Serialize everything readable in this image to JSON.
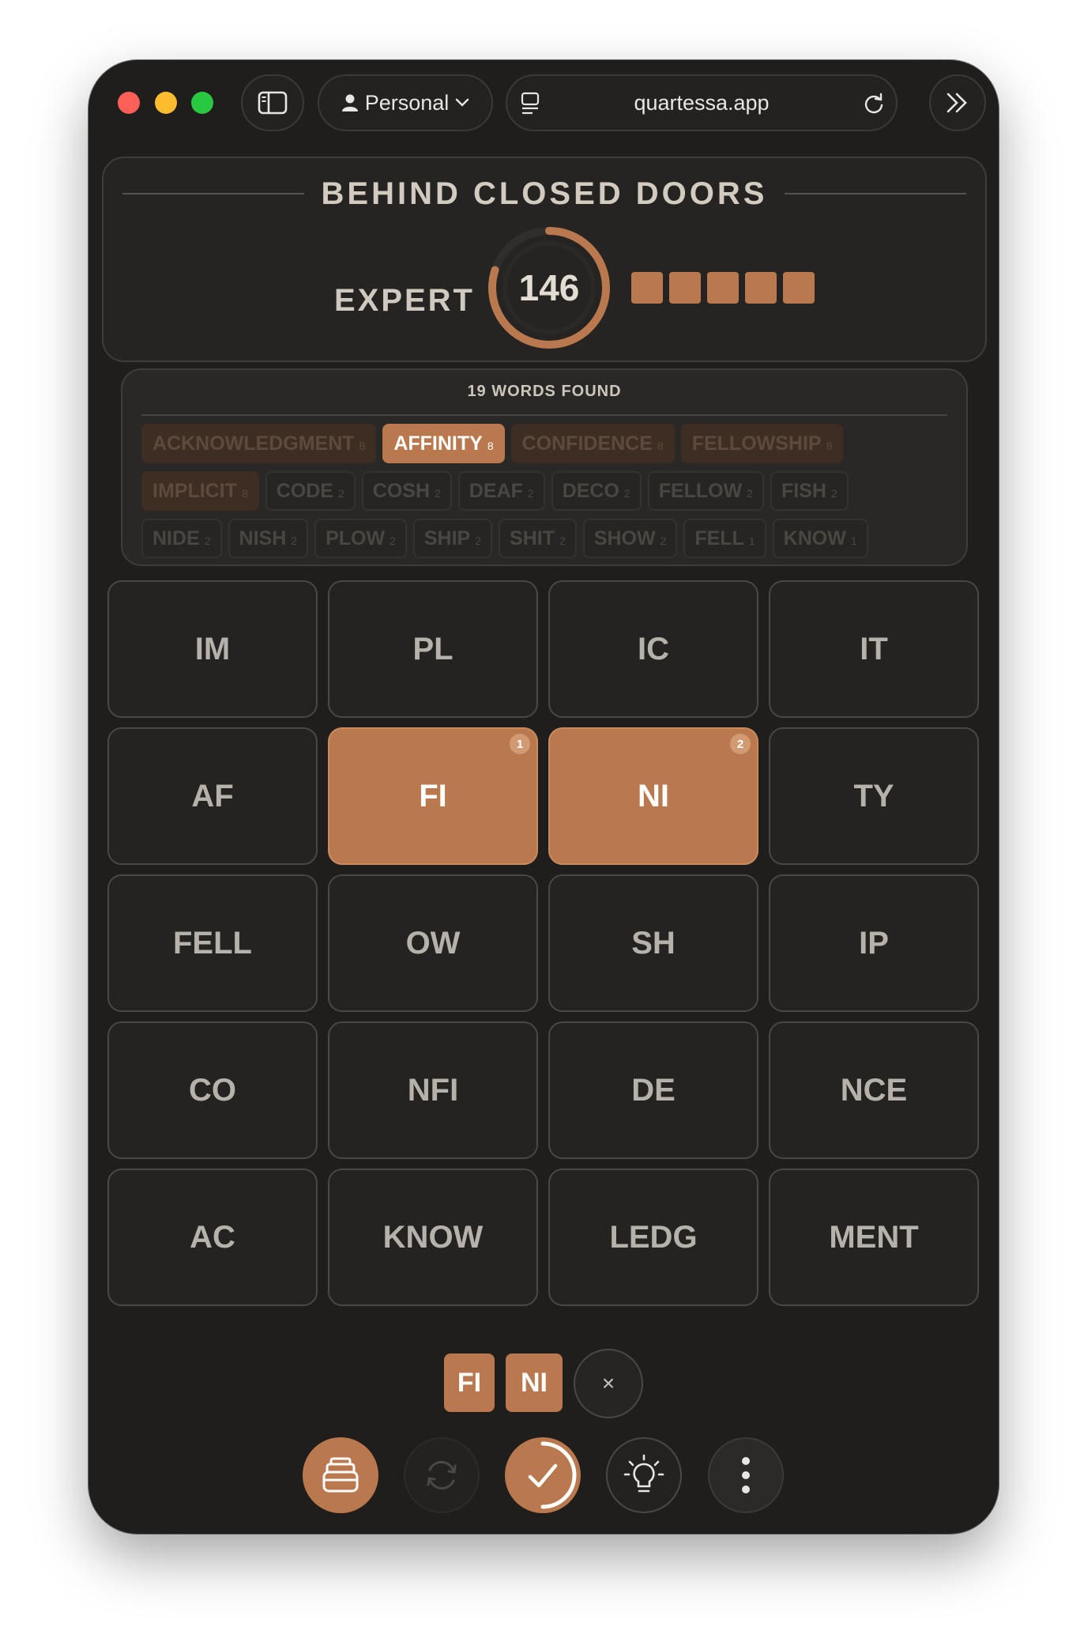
{
  "browser": {
    "profile_label": "Personal",
    "url": "quartessa.app"
  },
  "puzzle": {
    "title": "BEHIND CLOSED DOORS",
    "level": "EXPERT",
    "score": "146",
    "score_progress": 0.8,
    "progress_filled": 5
  },
  "found": {
    "title": "19 WORDS FOUND",
    "rows": [
      [
        {
          "word": "ACKNOWLEDGMENT",
          "count": "8",
          "kind": "big"
        },
        {
          "word": "AFFINITY",
          "count": "8",
          "kind": "active"
        },
        {
          "word": "CONFIDENCE",
          "count": "8",
          "kind": "big"
        },
        {
          "word": "FELLOWSHIP",
          "count": "8",
          "kind": "big"
        }
      ],
      [
        {
          "word": "IMPLICIT",
          "count": "8",
          "kind": "big"
        },
        {
          "word": "CODE",
          "count": "2",
          "kind": "small"
        },
        {
          "word": "COSH",
          "count": "2",
          "kind": "small"
        },
        {
          "word": "DEAF",
          "count": "2",
          "kind": "small"
        },
        {
          "word": "DECO",
          "count": "2",
          "kind": "small"
        },
        {
          "word": "FELLOW",
          "count": "2",
          "kind": "small"
        },
        {
          "word": "FISH",
          "count": "2",
          "kind": "small"
        }
      ],
      [
        {
          "word": "NIDE",
          "count": "2",
          "kind": "small"
        },
        {
          "word": "NISH",
          "count": "2",
          "kind": "small"
        },
        {
          "word": "PLOW",
          "count": "2",
          "kind": "small"
        },
        {
          "word": "SHIP",
          "count": "2",
          "kind": "small"
        },
        {
          "word": "SHIT",
          "count": "2",
          "kind": "small"
        },
        {
          "word": "SHOW",
          "count": "2",
          "kind": "small"
        },
        {
          "word": "FELL",
          "count": "1",
          "kind": "small"
        },
        {
          "word": "KNOW",
          "count": "1",
          "kind": "small"
        }
      ]
    ]
  },
  "tiles": [
    {
      "label": "IM"
    },
    {
      "label": "PL"
    },
    {
      "label": "IC"
    },
    {
      "label": "IT"
    },
    {
      "label": "AF"
    },
    {
      "label": "FI",
      "order": "1"
    },
    {
      "label": "NI",
      "order": "2"
    },
    {
      "label": "TY"
    },
    {
      "label": "FELL"
    },
    {
      "label": "OW"
    },
    {
      "label": "SH"
    },
    {
      "label": "IP"
    },
    {
      "label": "CO"
    },
    {
      "label": "NFI"
    },
    {
      "label": "DE"
    },
    {
      "label": "NCE"
    },
    {
      "label": "AC"
    },
    {
      "label": "KNOW"
    },
    {
      "label": "LEDG"
    },
    {
      "label": "MENT"
    }
  ],
  "selection": {
    "pieces": [
      "FI",
      "NI"
    ],
    "clear_label": "×"
  },
  "actions": {
    "words_icon": "stack-icon",
    "shuffle_icon": "shuffle-icon",
    "submit_icon": "check-icon",
    "hint_icon": "lightbulb-icon",
    "menu_icon": "more-vertical-icon"
  },
  "colors": {
    "accent": "#b9784d",
    "background": "#1f1e1c",
    "tile": "#242321"
  }
}
